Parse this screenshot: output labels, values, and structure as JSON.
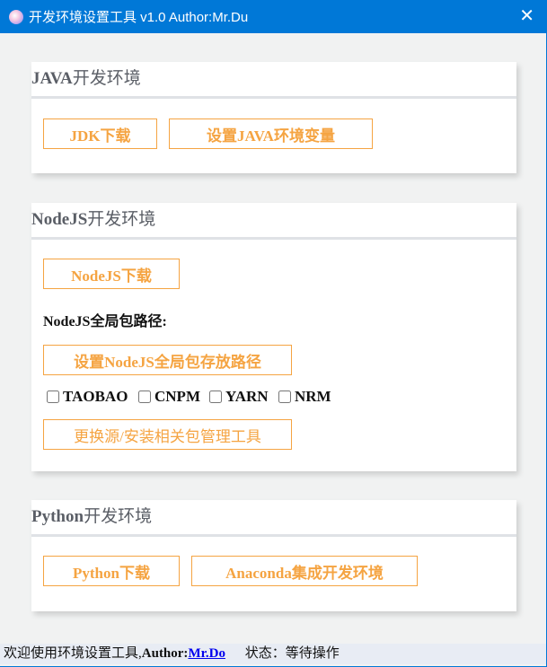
{
  "window": {
    "title": "开发环境设置工具 v1.0 Author:Mr.Du",
    "close": "✕"
  },
  "java": {
    "title_bold": "JAVA",
    "title_rest": "开发环境",
    "jdk_download": "JDK下载",
    "set_env": "设置JAVA环境变量"
  },
  "node": {
    "title_bold": "NodeJS",
    "title_rest": "开发环境",
    "download": "NodeJS下载",
    "global_path_label": "NodeJS全局包路径:",
    "set_global_path": "设置NodeJS全局包存放路径",
    "registries": [
      {
        "label": "TAOBAO",
        "checked": false
      },
      {
        "label": "CNPM",
        "checked": false
      },
      {
        "label": "YARN",
        "checked": false
      },
      {
        "label": "NRM",
        "checked": false
      }
    ],
    "change_source": "更换源/安装相关包管理工具"
  },
  "python": {
    "title_bold": "Python",
    "title_rest": "开发环境",
    "download": "Python下载",
    "anaconda": "Anaconda集成开发环境"
  },
  "status": {
    "welcome": "欢迎使用环境设置工具,",
    "author_label": "Author:",
    "author_link": "Mr.Do",
    "state": "状态：等待操作"
  }
}
